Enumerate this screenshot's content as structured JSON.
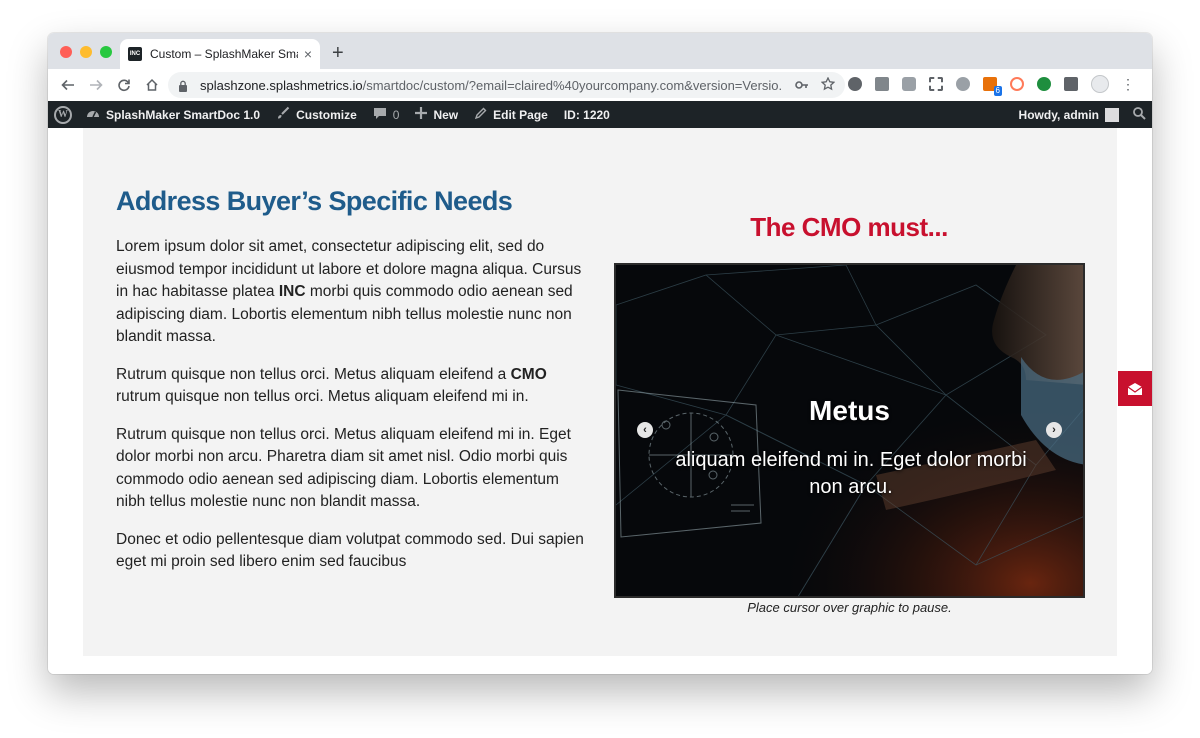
{
  "browser": {
    "tab_title": "Custom – SplashMaker SmartD",
    "tab_favicon_text": "INC",
    "tab_close": "×",
    "new_tab": "+",
    "url_host": "splashzone.splashmetrics.io",
    "url_path": "/smartdoc/custom/?email=claired%40yourcompany.com&version=Versio...",
    "extension_badge": "6"
  },
  "adminbar": {
    "site_name": "SplashMaker SmartDoc 1.0",
    "customize": "Customize",
    "comments_count": "0",
    "new": "New",
    "edit_page": "Edit Page",
    "page_id": "ID: 1220",
    "howdy": "Howdy, admin"
  },
  "content": {
    "heading": "Address Buyer’s Specific Needs",
    "p1_a": "Lorem ipsum dolor sit amet, consectetur adipiscing elit, sed do eiusmod tempor incididunt ut labore et dolore magna aliqua. Cursus in hac habitasse platea ",
    "p1_bold": "INC",
    "p1_b": " morbi quis commodo odio aenean sed adipiscing diam. Lobortis elementum nibh tellus molestie nunc non blandit massa.",
    "p2_a": "Rutrum quisque non tellus orci. Metus aliquam eleifend a ",
    "p2_bold": "CMO",
    "p2_b": " rutrum quisque non tellus orci. Metus aliquam eleifend mi in.",
    "p3": "Rutrum quisque non tellus orci. Metus aliquam eleifend mi in. Eget dolor morbi non arcu. Pharetra diam sit amet nisl. Odio morbi quis commodo odio aenean sed adipiscing diam. Lobortis elementum nibh tellus molestie nunc non blandit massa.",
    "p4": "Donec et odio pellentesque diam volutpat commodo sed. Dui sapien eget mi proin sed libero enim sed faucibus"
  },
  "slider": {
    "heading": "The CMO must...",
    "slide_title": "Metus",
    "slide_text": "aliquam eleifend mi in. Eget dolor morbi non arcu.",
    "prev": "‹",
    "next": "›",
    "caption": "Place cursor over graphic to pause."
  },
  "colors": {
    "heading_blue": "#1f5c8b",
    "accent_red": "#c8102e",
    "adminbar_bg": "#1d2327",
    "panel_bg": "#f3f3f3"
  }
}
